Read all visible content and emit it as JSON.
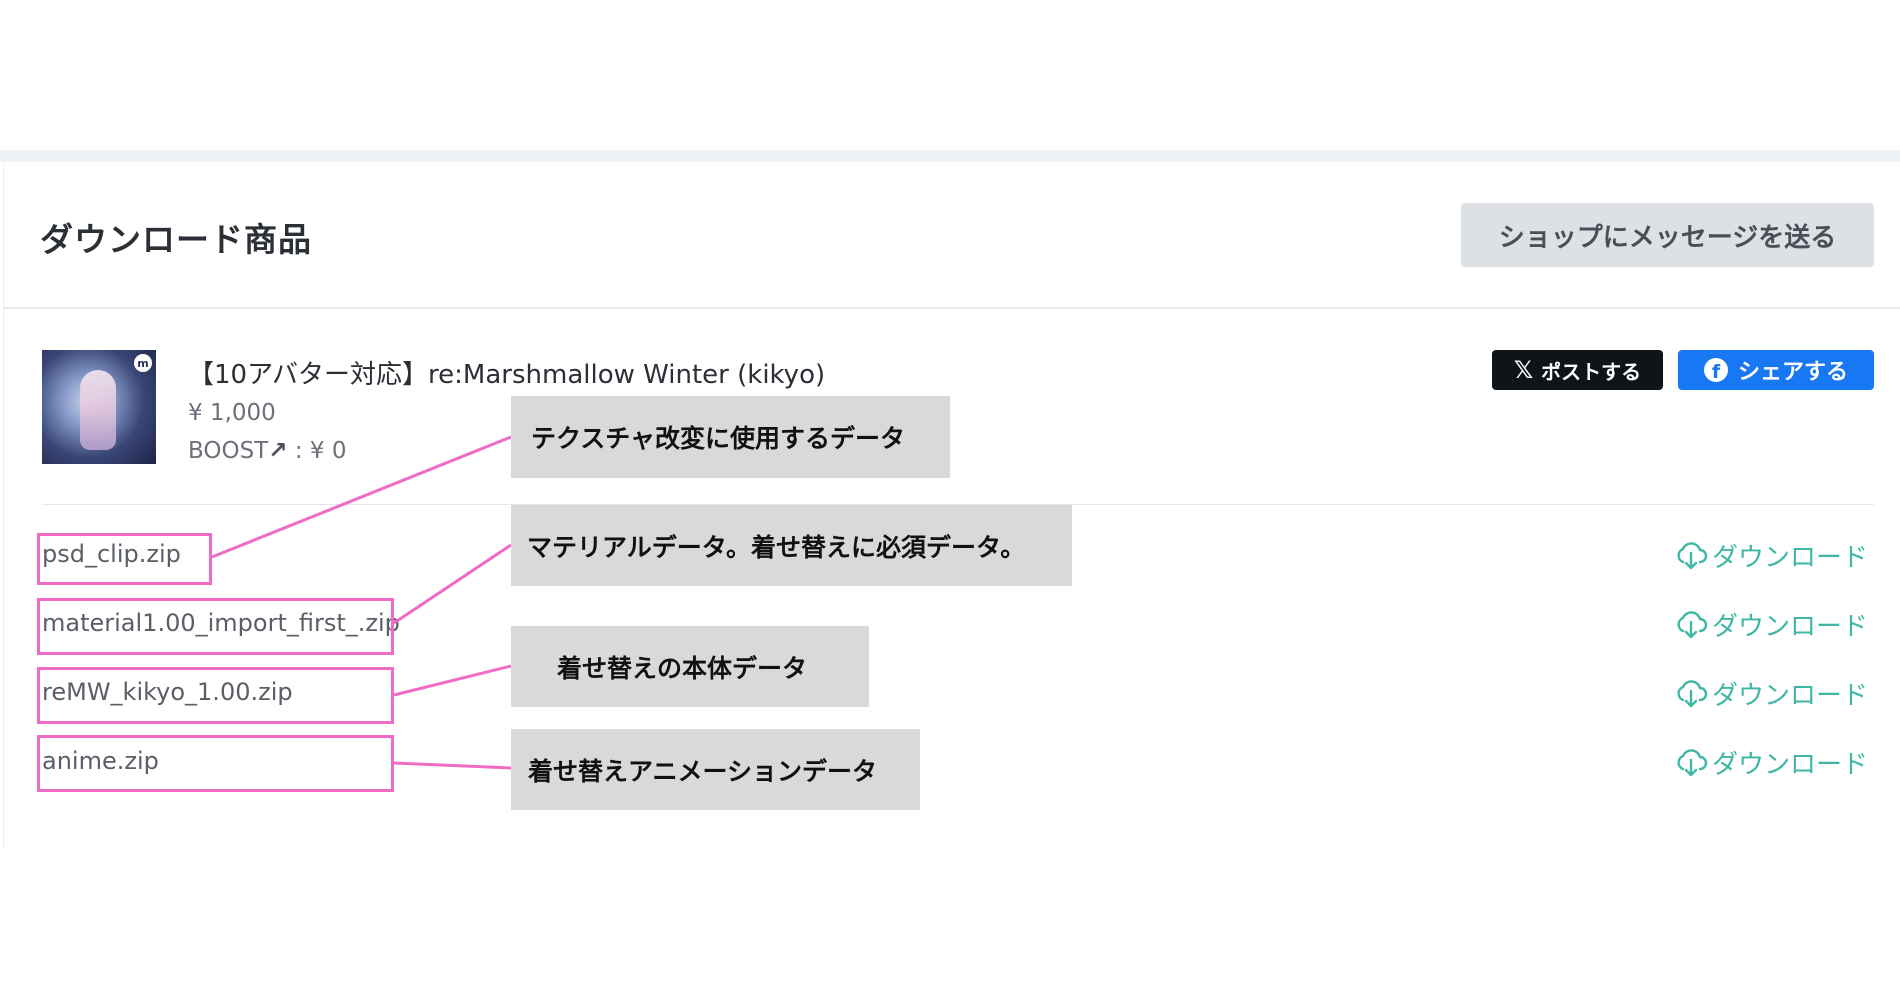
{
  "header": {
    "title": "ダウンロード商品",
    "message_button": "ショップにメッセージを送る"
  },
  "product": {
    "title": "【10アバター対応】re:Marshmallow Winter (kikyo)",
    "price": "¥ 1,000",
    "boost_label": "BOOST",
    "boost_arrow": "↗",
    "boost_value": " : ¥ 0",
    "thumbnail_icon": "product-thumbnail"
  },
  "share": {
    "x_label": "ポストする",
    "x_icon": "𝕏",
    "facebook_label": "シェアする",
    "facebook_icon": "f"
  },
  "files": [
    {
      "name": "psd_clip.zip",
      "download_label": "ダウンロード"
    },
    {
      "name": "material1.00_import_first_.zip",
      "download_label": "ダウンロード"
    },
    {
      "name": "reMW_kikyo_1.00.zip",
      "download_label": "ダウンロード"
    },
    {
      "name": "anime.zip",
      "download_label": "ダウンロード"
    }
  ],
  "annotations": [
    "テクスチャ改変に使用するデータ",
    "マテリアルデータ。着せ替えに必須データ。",
    "着せ替えの本体データ",
    "着せ替えアニメーションデータ"
  ],
  "colors": {
    "download_accent": "#3eb7a5",
    "annotation_pink": "#f06bc6",
    "facebook_blue": "#1877f2",
    "x_black": "#0f1419"
  }
}
